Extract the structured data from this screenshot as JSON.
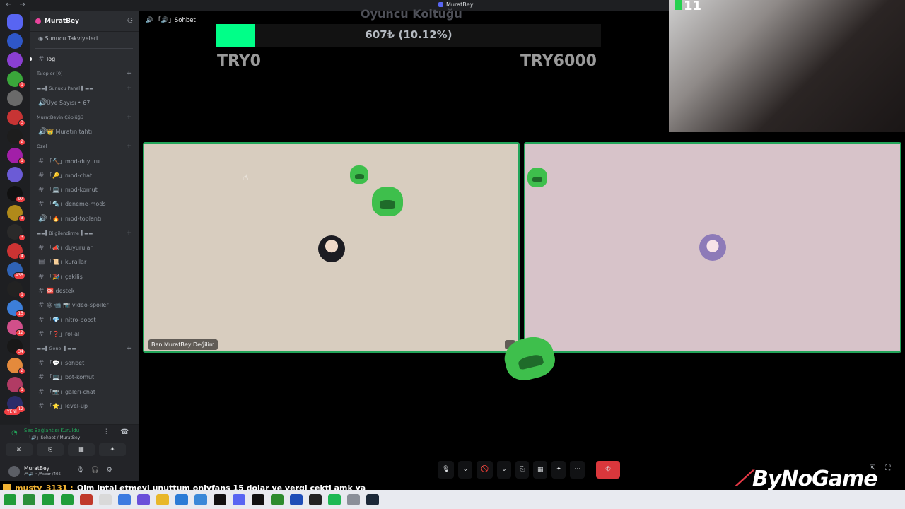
{
  "window": {
    "title": "MuratBey",
    "nav": "← →"
  },
  "server_list": {
    "servers": [
      {
        "badge": ""
      },
      {
        "badge": ""
      },
      {
        "badge": ""
      },
      {
        "badge": "1"
      },
      {
        "badge": ""
      },
      {
        "badge": "3"
      },
      {
        "badge": "2"
      },
      {
        "badge": "1"
      },
      {
        "badge": ""
      },
      {
        "badge": "97"
      },
      {
        "badge": "3"
      },
      {
        "badge": "3"
      },
      {
        "badge": "4"
      },
      {
        "badge": "435"
      },
      {
        "badge": "1"
      },
      {
        "badge": "15"
      },
      {
        "badge": "12"
      },
      {
        "badge": "34"
      },
      {
        "badge": "2"
      },
      {
        "badge": "1"
      },
      {
        "badge": "12"
      }
    ],
    "new_label": "YENİ"
  },
  "guild": {
    "name": "MuratBey",
    "boost": "Sunucu Takviyeleri",
    "channels": [
      {
        "type": "channel",
        "icon": "#",
        "label": "log",
        "active": true
      },
      {
        "type": "category",
        "label": "Talepler [0]"
      },
      {
        "type": "category",
        "label": "▬▬▌Sunucu Panel ▌▬▬"
      },
      {
        "type": "channel",
        "icon": "🔊",
        "label": "Üye Sayısı • 67"
      },
      {
        "type": "category",
        "label": "MuratBeyin Çöplüğü"
      },
      {
        "type": "channel",
        "icon": "🔊",
        "label": "👑 Muratın tahtı"
      },
      {
        "type": "category",
        "label": "Özel"
      },
      {
        "type": "channel",
        "icon": "#",
        "label": "「🔨」mod-duyuru"
      },
      {
        "type": "channel",
        "icon": "#",
        "label": "「🔑」mod-chat"
      },
      {
        "type": "channel",
        "icon": "#",
        "label": "「💻」mod-komut"
      },
      {
        "type": "channel",
        "icon": "#",
        "label": "「🔩」deneme-mods"
      },
      {
        "type": "channel",
        "icon": "🔊",
        "label": "「🔥」mod-toplantı"
      },
      {
        "type": "category",
        "label": "▬▬▌Bilgilendirme ▌▬▬"
      },
      {
        "type": "channel",
        "icon": "#",
        "label": "「📣」duyurular"
      },
      {
        "type": "channel",
        "icon": "▤",
        "label": "「📜」kurallar"
      },
      {
        "type": "channel",
        "icon": "#",
        "label": "「🎉」çekiliş"
      },
      {
        "type": "channel",
        "icon": "#",
        "label": "🆘 destek"
      },
      {
        "type": "channel",
        "icon": "#",
        "label": "😡 📹 📷 video-spoiler"
      },
      {
        "type": "channel",
        "icon": "#",
        "label": "「💎」nitro-boost"
      },
      {
        "type": "channel",
        "icon": "#",
        "label": "「❓」rol-al"
      },
      {
        "type": "category",
        "label": "▬▬▌Genel ▌▬▬"
      },
      {
        "type": "channel",
        "icon": "#",
        "label": "「💬」sohbet"
      },
      {
        "type": "channel",
        "icon": "#",
        "label": "「💻」bot-komut"
      },
      {
        "type": "channel",
        "icon": "#",
        "label": "「📷」galeri-chat"
      },
      {
        "type": "channel",
        "icon": "#",
        "label": "「⭐」level-up"
      }
    ]
  },
  "voice": {
    "status": "Ses Bağlantısı Kuruldu",
    "channel": "「🔊」Sohbet / MuratBey"
  },
  "user": {
    "name": "MuratBey",
    "subtitle": "🎮🔊 • /Asear /405"
  },
  "stage": {
    "channel": "「🔊」Sohbet"
  },
  "overlay": {
    "title": "Oyuncu Koltuğu",
    "progress_text": "607₺ (10.12%)",
    "progress_fraction": 0.1012,
    "min": "TRY0",
    "max": "TRY6000",
    "accent": "#00ff88"
  },
  "webcam": {
    "count": "11"
  },
  "participants": [
    {
      "name": "Ben MuratBey Değilim"
    },
    {
      "name": ""
    }
  ],
  "call_controls": [
    "🎙",
    "⌄",
    "🚫",
    "⌄",
    "⎘",
    "▦",
    "✦",
    "⋯",
    "✆"
  ],
  "chat": {
    "user": "musty_3131 :",
    "text": "Olm iptal etmeyi unuttum onlyfans 15 dolar ve vergi çekti amk ya"
  },
  "watermark": "ByNoGame",
  "colors": {
    "speaking": "#23a55a",
    "hangup": "#da373c",
    "brand": "#5865f2"
  }
}
